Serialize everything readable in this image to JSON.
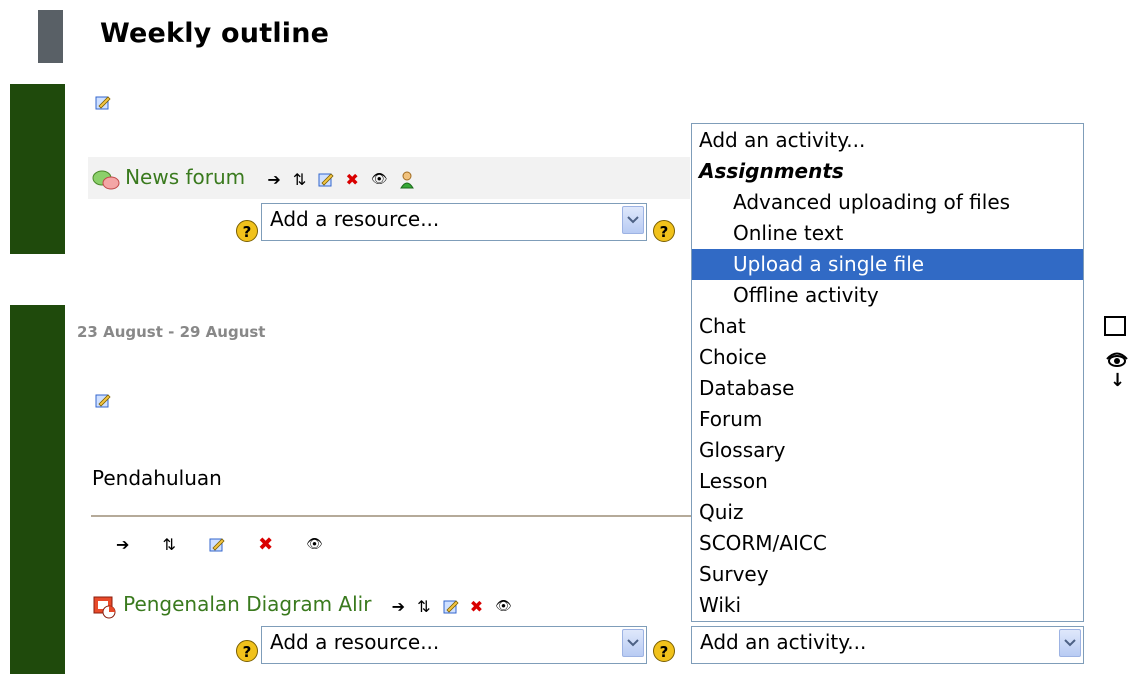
{
  "header": {
    "title": "Weekly outline"
  },
  "section0": {
    "forum_link": "News forum",
    "resource_select": "Add a resource..."
  },
  "section1": {
    "date": "23 August - 29 August",
    "summary": "Pendahuluan",
    "resource_link": "Pengenalan Diagram Alir",
    "resource_select": "Add a resource...",
    "activity_select": "Add an activity..."
  },
  "help_glyph": "?",
  "tools": {
    "move_right": "➔",
    "move_updown": "⇅",
    "delete": "✖",
    "hide": "👁"
  },
  "right_tools": {
    "move_down": "↓"
  },
  "activity_dropdown": {
    "items": [
      {
        "label": "Add an activity...",
        "kind": "normal"
      },
      {
        "label": "Assignments",
        "kind": "group"
      },
      {
        "label": "Advanced uploading of files",
        "kind": "indent"
      },
      {
        "label": "Online text",
        "kind": "indent"
      },
      {
        "label": "Upload a single file",
        "kind": "indent",
        "selected": true
      },
      {
        "label": "Offline activity",
        "kind": "indent"
      },
      {
        "label": "Chat",
        "kind": "normal"
      },
      {
        "label": "Choice",
        "kind": "normal"
      },
      {
        "label": "Database",
        "kind": "normal"
      },
      {
        "label": "Forum",
        "kind": "normal"
      },
      {
        "label": "Glossary",
        "kind": "normal"
      },
      {
        "label": "Lesson",
        "kind": "normal"
      },
      {
        "label": "Quiz",
        "kind": "normal"
      },
      {
        "label": "SCORM/AICC",
        "kind": "normal"
      },
      {
        "label": "Survey",
        "kind": "normal"
      },
      {
        "label": "Wiki",
        "kind": "normal"
      }
    ]
  },
  "colors": {
    "section_bar": "#1f4a0c",
    "link": "#3a7a1e",
    "selected_item": "#316ac5",
    "header_block": "#596066"
  }
}
